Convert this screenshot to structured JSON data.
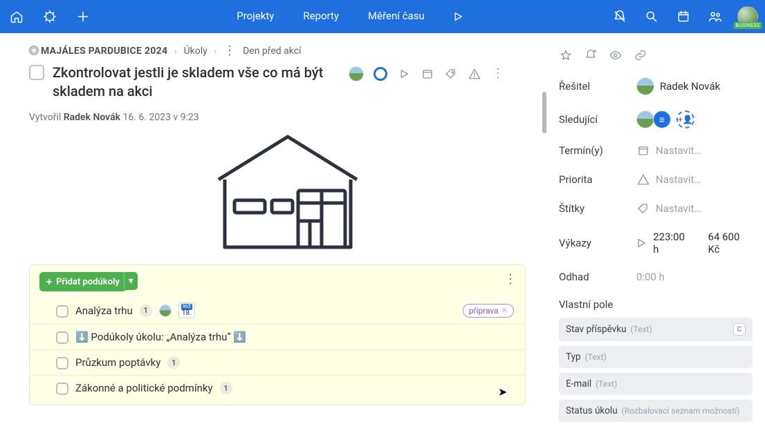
{
  "topbar": {
    "projects": "Projekty",
    "reports": "Reporty",
    "timetrack": "Měření času",
    "business": "BUSINESS"
  },
  "breadcrumb": {
    "project": "MAJÁLES PARDUBICE 2024",
    "tasks": "Úkoly",
    "current": "Den před akcí"
  },
  "task": {
    "title": "Zkontrolovat jestli je skladem vše co má být skladem na akci",
    "meta_prefix": "Vytvořil",
    "meta_author": "Radek Novák",
    "meta_date": "16. 6. 2023 v 9:23"
  },
  "subtasks": {
    "add": "Přidat podúkoly",
    "items": [
      {
        "title": "Analýza trhu",
        "count": "1",
        "date_top": "led",
        "date_bot": "18.",
        "tag": "příprava"
      },
      {
        "title": "⬇️ Podúkoly úkolu: „Analýza trhu“ ⬇️"
      },
      {
        "title": "Průzkum poptávky",
        "count": "1"
      },
      {
        "title": "Zákonné a politické podmínky",
        "count": "1"
      }
    ]
  },
  "side": {
    "resitel_label": "Řešitel",
    "resitel_value": "Radek Novák",
    "sledujici": "Sledující",
    "terminy": "Termín(y)",
    "priorita": "Priorita",
    "stitky": "Štítky",
    "nastavit": "Nastavit…",
    "vykazy": "Výkazy",
    "vykazy_hours": "223:00 h",
    "vykazy_cost": "64 600 Kč",
    "odhad": "Odhad",
    "odhad_val": "0:00 h",
    "custom": "Vlastní pole",
    "fields": [
      {
        "name": "Stav příspěvku",
        "type": "(Text)",
        "badge": "C"
      },
      {
        "name": "Typ",
        "type": "(Text)"
      },
      {
        "name": "E-mail",
        "type": "(Text)"
      },
      {
        "name": "Status úkolu",
        "type": "(Rozbalovací seznam možností)"
      }
    ]
  }
}
